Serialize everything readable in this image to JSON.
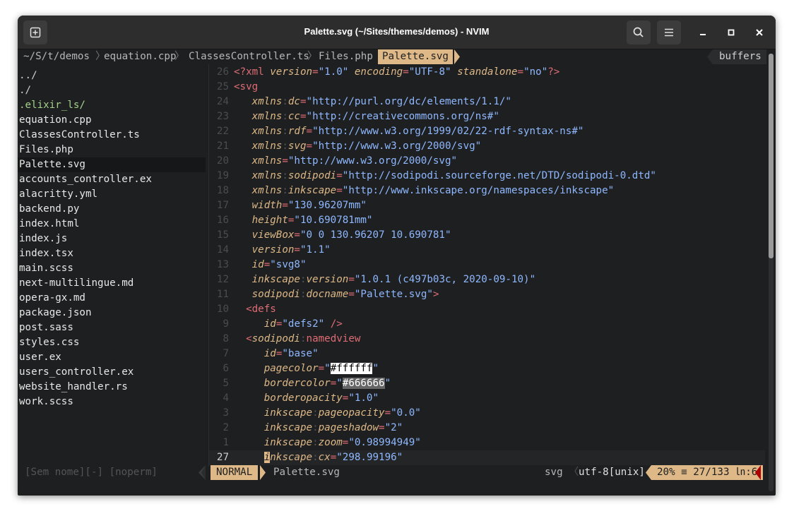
{
  "window": {
    "title": "Palette.svg (~/Sites/themes/demos) - NVIM",
    "icons": {
      "new_tab": "new-tab-icon",
      "search": "search-icon",
      "menu": "hamburger-menu-icon",
      "minimize": "minimize-icon",
      "maximize": "maximize-icon",
      "close": "close-icon"
    }
  },
  "tabline": {
    "path": "~/S/t/demos",
    "tabs": [
      "equation.cpp",
      "ClassesController.ts",
      "Files.php",
      "Palette.svg"
    ],
    "active_tab": "Palette.svg",
    "buffers_label": "buffers"
  },
  "tree": {
    "items": [
      "../",
      "./",
      ".elixir_ls/",
      "equation.cpp",
      "ClassesController.ts",
      "Files.php",
      "Palette.svg",
      "accounts_controller.ex",
      "alacritty.yml",
      "backend.py",
      "index.html",
      "index.js",
      "index.tsx",
      "main.scss",
      "next-multilingue.md",
      "opera-gx.md",
      "package.json",
      "post.sass",
      "styles.css",
      "user.ex",
      "users_controller.ex",
      "website_handler.rs",
      "work.scss"
    ],
    "selected_index": 6,
    "status": "[Sem nome][-] [noperm]"
  },
  "editor": {
    "lines": [
      {
        "num": "26",
        "text": "<?xml version=\"1.0\" encoding=\"UTF-8\" standalone=\"no\"?>"
      },
      {
        "num": "25",
        "text": "<svg"
      },
      {
        "num": "24",
        "text": "   xmlns:dc=\"http://purl.org/dc/elements/1.1/\""
      },
      {
        "num": "23",
        "text": "   xmlns:cc=\"http://creativecommons.org/ns#\""
      },
      {
        "num": "22",
        "text": "   xmlns:rdf=\"http://www.w3.org/1999/02/22-rdf-syntax-ns#\""
      },
      {
        "num": "21",
        "text": "   xmlns:svg=\"http://www.w3.org/2000/svg\""
      },
      {
        "num": "20",
        "text": "   xmlns=\"http://www.w3.org/2000/svg\""
      },
      {
        "num": "19",
        "text": "   xmlns:sodipodi=\"http://sodipodi.sourceforge.net/DTD/sodipodi-0.dtd\""
      },
      {
        "num": "18",
        "text": "   xmlns:inkscape=\"http://www.inkscape.org/namespaces/inkscape\""
      },
      {
        "num": "17",
        "text": "   width=\"130.96207mm\""
      },
      {
        "num": "16",
        "text": "   height=\"10.690781mm\""
      },
      {
        "num": "15",
        "text": "   viewBox=\"0 0 130.96207 10.690781\""
      },
      {
        "num": "14",
        "text": "   version=\"1.1\""
      },
      {
        "num": "13",
        "text": "   id=\"svg8\""
      },
      {
        "num": "12",
        "text": "   inkscape:version=\"1.0.1 (c497b03c, 2020-09-10)\""
      },
      {
        "num": "11",
        "text": "   sodipodi:docname=\"Palette.svg\">"
      },
      {
        "num": "10",
        "text": "  <defs"
      },
      {
        "num": "9",
        "text": "     id=\"defs2\" />"
      },
      {
        "num": "8",
        "text": "  <sodipodi:namedview"
      },
      {
        "num": "7",
        "text": "     id=\"base\""
      },
      {
        "num": "6",
        "text": "     pagecolor=\"#ffffff\""
      },
      {
        "num": "5",
        "text": "     bordercolor=\"#666666\""
      },
      {
        "num": "4",
        "text": "     borderopacity=\"1.0\""
      },
      {
        "num": "3",
        "text": "     inkscape:pageopacity=\"0.0\""
      },
      {
        "num": "2",
        "text": "     inkscape:pageshadow=\"2\""
      },
      {
        "num": "1",
        "text": "     inkscape:zoom=\"0.98994949\""
      },
      {
        "num": "27",
        "text": "     inkscape:cx=\"298.99196\""
      }
    ],
    "current_line_index": 26
  },
  "statusline": {
    "mode": "NORMAL",
    "filename": "Palette.svg",
    "filetype": "svg",
    "encoding": "utf-8[unix]",
    "position": "20% ≡ 27/133 ㏑:6"
  },
  "colors": {
    "accent": "#deb887",
    "background": "#1d1f21",
    "tag": "#e06c75",
    "string": "#8fb8ff",
    "mode_bg": "#deb887"
  }
}
